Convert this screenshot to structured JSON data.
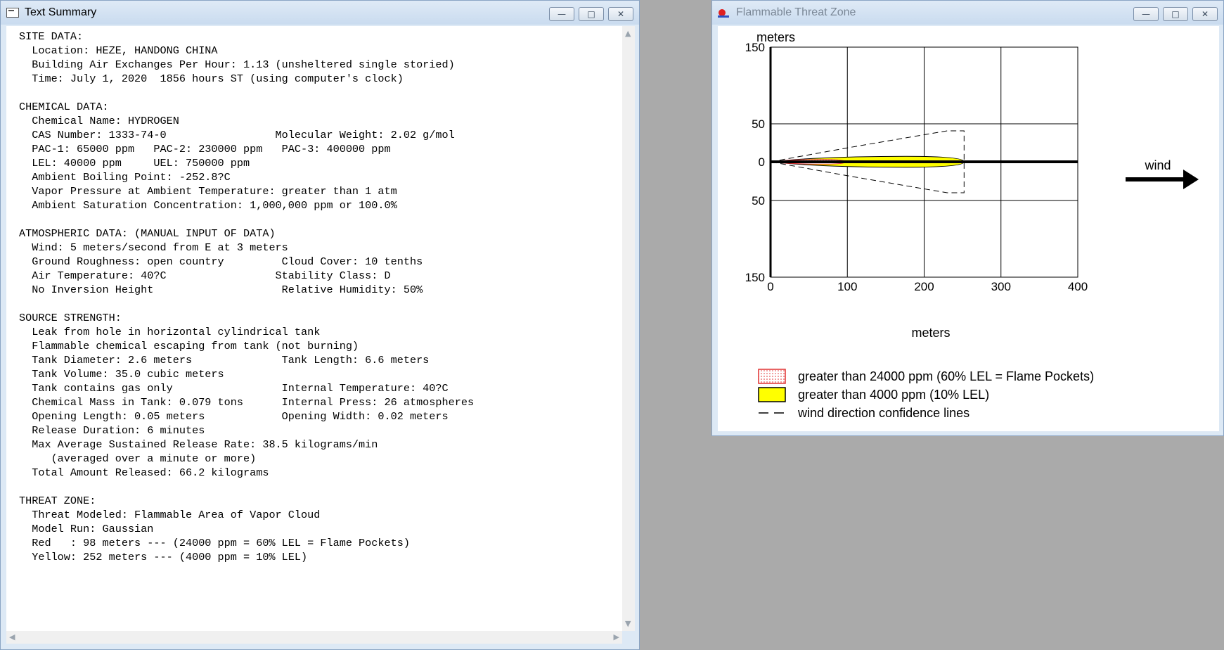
{
  "text_window": {
    "title": "Text Summary",
    "controls": {
      "minimize": "—",
      "maximize": "□",
      "close": "✕"
    },
    "lines": [
      "SITE DATA:",
      "  Location: HEZE, HANDONG CHINA",
      "  Building Air Exchanges Per Hour: 1.13 (unsheltered single storied)",
      "  Time: July 1, 2020  1856 hours ST (using computer's clock)",
      "",
      "CHEMICAL DATA:",
      "  Chemical Name: HYDROGEN",
      "  CAS Number: 1333-74-0                 Molecular Weight: 2.02 g/mol",
      "  PAC-1: 65000 ppm   PAC-2: 230000 ppm   PAC-3: 400000 ppm",
      "  LEL: 40000 ppm     UEL: 750000 ppm",
      "  Ambient Boiling Point: -252.8?C",
      "  Vapor Pressure at Ambient Temperature: greater than 1 atm",
      "  Ambient Saturation Concentration: 1,000,000 ppm or 100.0%",
      "",
      "ATMOSPHERIC DATA: (MANUAL INPUT OF DATA)",
      "  Wind: 5 meters/second from E at 3 meters",
      "  Ground Roughness: open country         Cloud Cover: 10 tenths",
      "  Air Temperature: 40?C                 Stability Class: D",
      "  No Inversion Height                    Relative Humidity: 50%",
      "",
      "SOURCE STRENGTH:",
      "  Leak from hole in horizontal cylindrical tank",
      "  Flammable chemical escaping from tank (not burning)",
      "  Tank Diameter: 2.6 meters              Tank Length: 6.6 meters",
      "  Tank Volume: 35.0 cubic meters",
      "  Tank contains gas only                 Internal Temperature: 40?C",
      "  Chemical Mass in Tank: 0.079 tons      Internal Press: 26 atmospheres",
      "  Opening Length: 0.05 meters            Opening Width: 0.02 meters",
      "  Release Duration: 6 minutes",
      "  Max Average Sustained Release Rate: 38.5 kilograms/min",
      "     (averaged over a minute or more)",
      "  Total Amount Released: 66.2 kilograms",
      "",
      "THREAT ZONE:",
      "  Threat Modeled: Flammable Area of Vapor Cloud",
      "  Model Run: Gaussian",
      "  Red   : 98 meters --- (24000 ppm = 60% LEL = Flame Pockets)",
      "  Yellow: 252 meters --- (4000 ppm = 10% LEL)"
    ]
  },
  "plot_window": {
    "title": "Flammable Threat Zone",
    "controls": {
      "minimize": "—",
      "maximize": "□",
      "close": "✕"
    },
    "y_unit": "meters",
    "x_unit": "meters",
    "wind_label": "wind",
    "legend": [
      {
        "label": "greater than 24000 ppm (60% LEL = Flame Pockets)",
        "color": "#e03030",
        "style": "dotted"
      },
      {
        "label": "greater than 4000 ppm (10% LEL)",
        "color": "#ffff00",
        "style": "solid"
      },
      {
        "label": "wind direction confidence lines",
        "color": "#000000",
        "style": "dashed"
      }
    ]
  },
  "chart_data": {
    "type": "area",
    "x_ticks": [
      0,
      100,
      200,
      300,
      400
    ],
    "y_ticks": [
      150,
      50,
      0,
      50,
      150
    ],
    "xlim": [
      0,
      400
    ],
    "ylim": [
      -150,
      150
    ],
    "grid": true,
    "zones": [
      {
        "name": "Red",
        "distance": 98,
        "max_halfwidth": 3,
        "color": "#e03030"
      },
      {
        "name": "Yellow",
        "distance": 252,
        "max_halfwidth": 7,
        "color": "#ffff00"
      }
    ],
    "confidence_lines": {
      "x": [
        0,
        100,
        200,
        230,
        252
      ],
      "halfwidth": [
        0,
        18,
        35,
        40,
        40
      ]
    }
  }
}
